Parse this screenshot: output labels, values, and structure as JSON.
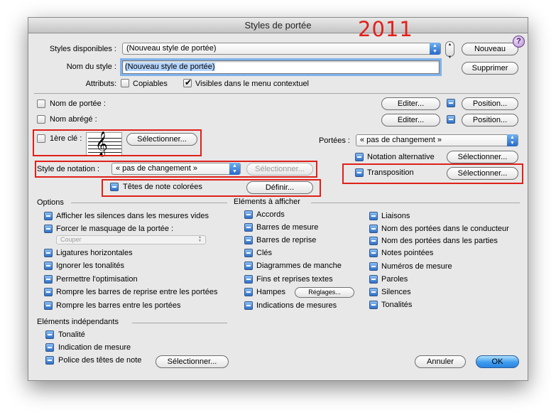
{
  "window": {
    "title": "Styles de portée",
    "annotation": "2011"
  },
  "header": {
    "styles_label": "Styles disponibles :",
    "styles_value": "(Nouveau style de portée)",
    "name_label": "Nom du style :",
    "name_value": "(Nouveau style de portée)",
    "attributes_label": "Attributs:",
    "copiables": "Copiables",
    "visibles": "Visibles dans le menu contextuel",
    "nouveau": "Nouveau",
    "supprimer": "Supprimer",
    "help": "?"
  },
  "rows": {
    "nom_portee": "Nom de portée :",
    "nom_abrege": "Nom abrégé :",
    "editer": "Editer...",
    "position": "Position...",
    "cle": "1ère clé :",
    "selectionner": "Sélectionner...",
    "portees_label": "Portées :",
    "portees_value": "« pas de changement »",
    "notation_alt": "Notation alternative",
    "style_notation_label": "Style de notation :",
    "style_notation_value": "« pas de changement »",
    "transposition": "Transposition",
    "tetes": "Têtes de note colorées",
    "definir": "Définir..."
  },
  "options": {
    "title": "Options",
    "items": [
      "Afficher les silences dans les mesures vides",
      "Forcer le masquage de la portée :",
      "Ligatures horizontales",
      "Ignorer les tonalités",
      "Permettre l'optimisation",
      "Rompre les barres de reprise entre les portées",
      "Rompre les barres entre les portées"
    ],
    "couper": "Couper"
  },
  "elements": {
    "title": "Eléments à afficher",
    "col1": [
      "Accords",
      "Barres de mesure",
      "Barres de reprise",
      "Clés",
      "Diagrammes de manche",
      "Fins et reprises textes",
      "Hampes",
      "Indications de mesures"
    ],
    "reglages": "Réglages...",
    "col2": [
      "Liaisons",
      "Nom des portées dans le conducteur",
      "Nom des portées dans les parties",
      "Notes pointées",
      "Numéros de mesure",
      "Paroles",
      "Silences",
      "Tonalités"
    ]
  },
  "independants": {
    "title": "Eléments indépendants",
    "items": [
      "Tonalité",
      "Indication de mesure",
      "Police des têtes de note"
    ],
    "selectionner": "Sélectionner..."
  },
  "footer": {
    "annuler": "Annuler",
    "ok": "OK"
  }
}
